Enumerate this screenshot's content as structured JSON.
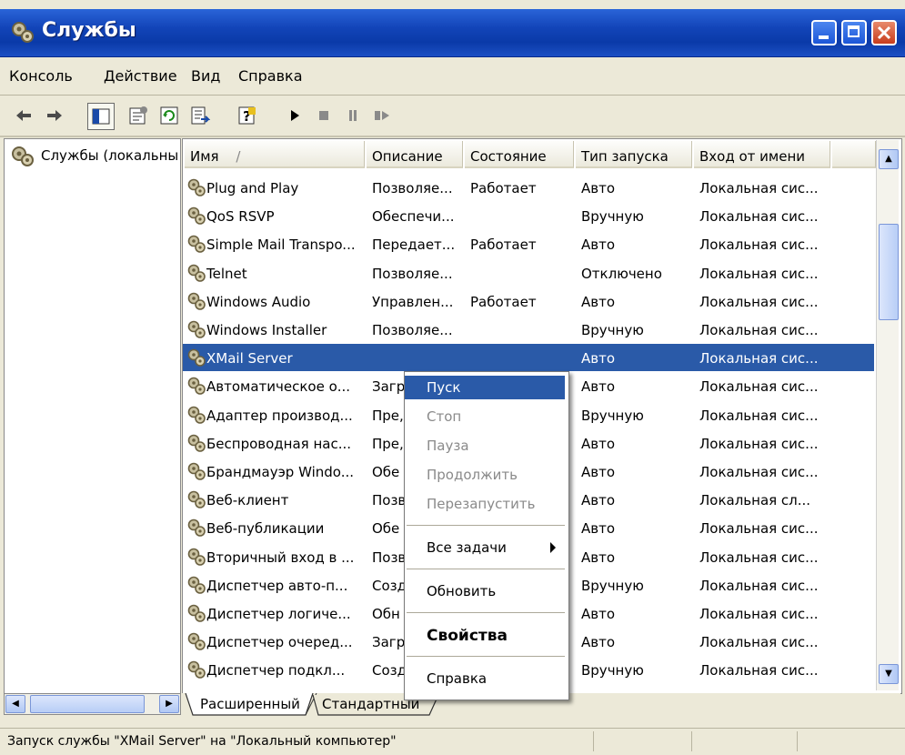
{
  "window": {
    "title": "Службы"
  },
  "menubar": {
    "items": [
      "Консоль",
      "Действие",
      "Вид",
      "Справка"
    ]
  },
  "toolbar": {
    "icons": [
      "back-arrow-icon",
      "forward-arrow-icon",
      "show-hide-tree-icon",
      "properties-icon",
      "refresh-icon",
      "export-list-icon",
      "help-icon",
      "start-service-icon",
      "stop-service-icon",
      "pause-service-icon",
      "restart-service-icon"
    ]
  },
  "tree": {
    "label": "Службы (локальны"
  },
  "list": {
    "columns": [
      {
        "label": "Имя",
        "sort_indicator": "/"
      },
      {
        "label": "Описание"
      },
      {
        "label": "Состояние"
      },
      {
        "label": "Тип запуска"
      },
      {
        "label": "Вход от имени"
      }
    ],
    "rows": [
      {
        "name": "Plug and Play",
        "description": "Позволяе...",
        "state": "Работает",
        "startup": "Авто",
        "logon": "Локальная сис..."
      },
      {
        "name": "QoS RSVP",
        "description": "Обеспечи...",
        "state": "",
        "startup": "Вручную",
        "logon": "Локальная сис..."
      },
      {
        "name": "Simple Mail Transpo...",
        "description": "Передает...",
        "state": "Работает",
        "startup": "Авто",
        "logon": "Локальная сис..."
      },
      {
        "name": "Telnet",
        "description": "Позволяе...",
        "state": "",
        "startup": "Отключено",
        "logon": "Локальная сис..."
      },
      {
        "name": "Windows Audio",
        "description": "Управлен...",
        "state": "Работает",
        "startup": "Авто",
        "logon": "Локальная сис..."
      },
      {
        "name": "Windows Installer",
        "description": "Позволяе...",
        "state": "",
        "startup": "Вручную",
        "logon": "Локальная сис..."
      },
      {
        "name": "XMail Server",
        "description": "",
        "state": "",
        "startup": "Авто",
        "logon": "Локальная сис..."
      },
      {
        "name": "Автоматическое о...",
        "description": "Загр",
        "state": "",
        "startup": "Авто",
        "logon": "Локальная сис..."
      },
      {
        "name": "Адаптер производ...",
        "description": "Пре,",
        "state": "",
        "startup": "Вручную",
        "logon": "Локальная сис..."
      },
      {
        "name": "Беспроводная нас...",
        "description": "Пре,",
        "state": "",
        "startup": "Авто",
        "logon": "Локальная сис..."
      },
      {
        "name": "Брандмауэр Windo...",
        "description": "Обе",
        "state": "",
        "startup": "Авто",
        "logon": "Локальная сис..."
      },
      {
        "name": "Веб-клиент",
        "description": "Позв",
        "state": "",
        "startup": "Авто",
        "logon": "Локальная сл..."
      },
      {
        "name": "Веб-публикации",
        "description": "Обе",
        "state": "",
        "startup": "Авто",
        "logon": "Локальная сис..."
      },
      {
        "name": "Вторичный вход в ...",
        "description": "Позв",
        "state": "",
        "startup": "Авто",
        "logon": "Локальная сис..."
      },
      {
        "name": "Диспетчер авто-п...",
        "description": "Созд",
        "state": "",
        "startup": "Вручную",
        "logon": "Локальная сис..."
      },
      {
        "name": "Диспетчер логиче...",
        "description": "Обн",
        "state": "",
        "startup": "Авто",
        "logon": "Локальная сис..."
      },
      {
        "name": "Диспетчер очеред...",
        "description": "Загр",
        "state": "",
        "startup": "Авто",
        "logon": "Локальная сис..."
      },
      {
        "name": "Диспетчер подкл...",
        "description": "Созд",
        "state": "",
        "startup": "Вручную",
        "logon": "Локальная сис..."
      }
    ]
  },
  "context_menu": {
    "items": [
      "Пуск",
      "Стоп",
      "Пауза",
      "Продолжить",
      "Перезапустить",
      "Все задачи",
      "Обновить",
      "Свойства",
      "Справка"
    ]
  },
  "tabs": [
    "Расширенный",
    "Стандартный"
  ],
  "statusbar": {
    "text": "Запуск службы \"XMail Server\" на \"Локальный компьютер\""
  },
  "colors": {
    "titlebar": "#0a3aa8",
    "selection": "#2a5aa8",
    "chrome": "#ece9d8"
  }
}
